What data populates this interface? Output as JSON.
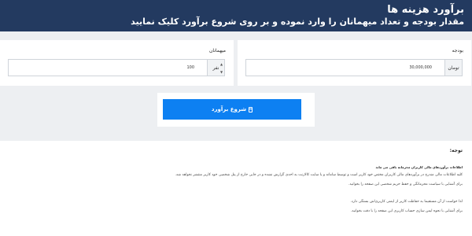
{
  "header": {
    "title": "برآورد هزینه ها",
    "subtitle": "مقدار بودجه و تعداد میهمانان را وارد نموده و بر روی شروع برآورد کلیک نمایید"
  },
  "budget": {
    "label": "بودجه",
    "unit": "تومان",
    "value": "30,000,000"
  },
  "guests": {
    "label": "میهمانان",
    "unit": "نفر",
    "value": "100"
  },
  "start_button": {
    "label": "شروع برآورد",
    "icon": "calculator-icon"
  },
  "note": {
    "title": "توجه:",
    "heading": "اطلاعات برآوردهای مالی کاربران محرمانه باقی می ماند",
    "lines": [
      "کلیه اطلاعات مالی مندرج در برآوردهای مالی کاربران مختص خود کاربر است و توسط سامانه و یا سایت کالارنت به احدی گزارش نشده و در جایی خارج از پنل شخصی خود کاربر منتشر نخواهد شد.",
      "برای آشنایی با سیاست محرمانگی و حفظ حریم شخصی این صفحه را بخوانید.",
      "لذا خواست از آن مستقیما به حفاظت کاربر از ایمنی کاربری‌اش بستگی دارد.",
      "برای آشنایی با نحوه ایمن سازی حساب کاربری این صفحه را با دقت بخوانید."
    ]
  }
}
